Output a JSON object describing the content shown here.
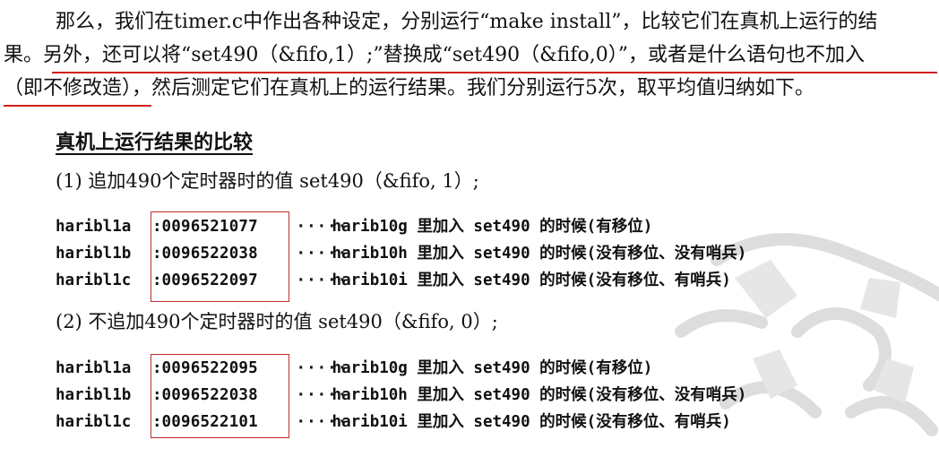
{
  "paragraph": {
    "line1": "那么，我们在timer.c中作出各种设定，分别运行“make install”，比较它们在真机上运行的结",
    "line2": "果。另外，还可以将“set490（&fifo,1）;”替换成“set490（&fifo,0）”，或者是什么语句也不加入",
    "line3": "（即不修改造），然后测定它们在真机上的运行结果。我们分别运行5次，取平均值归纳如下。"
  },
  "section_heading": "真机上运行结果的比较",
  "cases": [
    {
      "label": "(1) 追加490个定时器时的值 set490（&fifo, 1）;",
      "rows": [
        {
          "name": "haribl1a",
          "sep": ":",
          "value": "0096521077",
          "dots": "·····",
          "desc": "harib10g 里加入 set490 的时候(有移位)"
        },
        {
          "name": "haribl1b",
          "sep": ":",
          "value": "0096522038",
          "dots": "·····",
          "desc": "harib10h 里加入 set490 的时候(没有移位、没有哨兵)"
        },
        {
          "name": "haribl1c",
          "sep": ":",
          "value": "0096522097",
          "dots": "·····",
          "desc": "harib10i 里加入 set490 的时候(没有移位、有哨兵)"
        }
      ]
    },
    {
      "label": "(2) 不追加490个定时器时的值 set490（&fifo, 0）;",
      "rows": [
        {
          "name": "haribl1a",
          "sep": ":",
          "value": "0096522095",
          "dots": "·····",
          "desc": "harib10g 里加入 set490 的时候(有移位)"
        },
        {
          "name": "haribl1b",
          "sep": ":",
          "value": "0096522038",
          "dots": "·····",
          "desc": "harib10h 里加入 set490 的时候(没有移位、没有哨兵)"
        },
        {
          "name": "haribl1c",
          "sep": ":",
          "value": "0096522101",
          "dots": "·····",
          "desc": "harib10i 里加入 set490 的时候(没有移位、有哨兵)"
        }
      ]
    }
  ],
  "colors": {
    "text": "#111111",
    "highlight_red": "#c62a2a",
    "watermark": "#e6e6e6"
  }
}
